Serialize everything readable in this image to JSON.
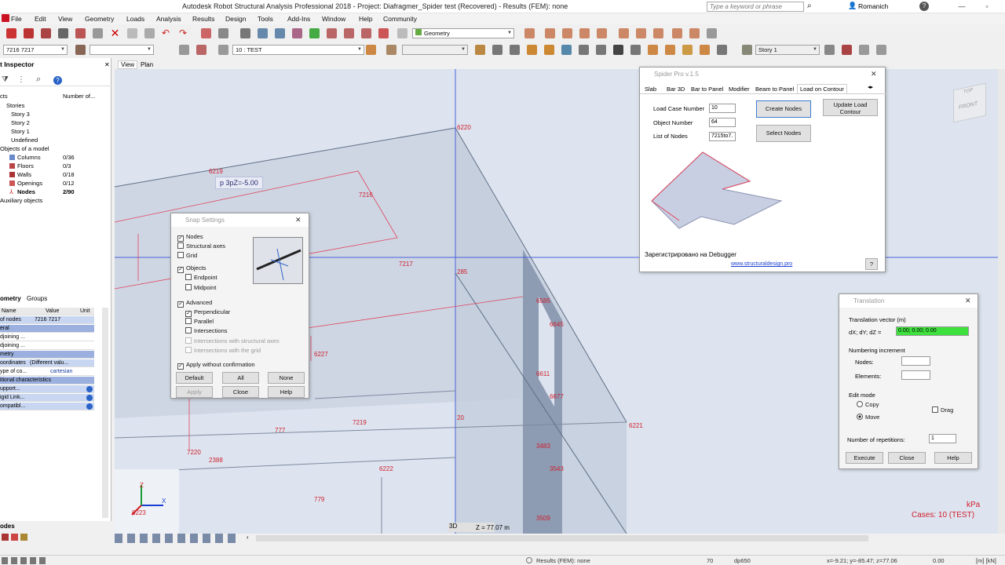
{
  "titlebar": {
    "title": "Autodesk Robot Structural Analysis Professional 2018 - Project: Diafragmer_Spider test (Recovered) - Results (FEM): none",
    "search_placeholder": "Type a keyword or phrase",
    "user": "Romanich"
  },
  "menu": [
    "File",
    "Edit",
    "View",
    "Geometry",
    "Loads",
    "Analysis",
    "Results",
    "Design",
    "Tools",
    "Add-Ins",
    "Window",
    "Help",
    "Community"
  ],
  "toolbar": {
    "geometry_combo": "Geometry",
    "node_combo": "7216 7217",
    "case_combo": "10 : TEST",
    "story_combo": "Story 1"
  },
  "inspector": {
    "title": "t Inspector",
    "col1": "cts",
    "col2": "Number of...",
    "tree": [
      {
        "label": "Stories",
        "count": ""
      },
      {
        "label": "Story 3",
        "count": ""
      },
      {
        "label": "Story 2",
        "count": ""
      },
      {
        "label": "Story 1",
        "count": ""
      },
      {
        "label": "Undefined",
        "count": ""
      },
      {
        "label": "Objects of a model",
        "count": ""
      },
      {
        "label": "Columns",
        "count": "0/36"
      },
      {
        "label": "Floors",
        "count": "0/3"
      },
      {
        "label": "Walls",
        "count": "0/18"
      },
      {
        "label": "Openings",
        "count": "0/12"
      },
      {
        "label": "Nodes",
        "count": "2/90"
      },
      {
        "label": "Auxiliary objects",
        "count": ""
      }
    ]
  },
  "propgrid": {
    "tab1": "ometry",
    "tab2": "Groups",
    "headers": [
      "Name",
      "Value",
      "Unit"
    ],
    "rows": [
      {
        "name": "of nodes",
        "value": "7216 7217",
        "type": "hl"
      },
      {
        "name": "eral",
        "value": "",
        "type": "sec"
      },
      {
        "name": "djoining ...",
        "value": "",
        "type": ""
      },
      {
        "name": "djoining ...",
        "value": "",
        "type": ""
      },
      {
        "name": "metry",
        "value": "",
        "type": "sec"
      },
      {
        "name": "oordinates",
        "value": "(Different valu...",
        "type": "hl"
      },
      {
        "name": "ype of co...",
        "value": "cartesian",
        "type": ""
      },
      {
        "name": "itional characteristics",
        "value": "",
        "type": "sec"
      },
      {
        "name": "upport...",
        "value": "",
        "type": "hl"
      },
      {
        "name": "igid Link...",
        "value": "",
        "type": "hl"
      },
      {
        "name": "ompatibl...",
        "value": "",
        "type": "hl"
      }
    ],
    "bottom_tab": "odes"
  },
  "view_tabs": [
    "View",
    "Plan"
  ],
  "viewport": {
    "nodes": [
      "6220",
      "6219",
      "7216",
      "7217",
      "285",
      "6585",
      "6645",
      "6611",
      "6677",
      "6221",
      "6227",
      "7219",
      "777",
      "7220",
      "2388",
      "6222",
      "3483",
      "3543",
      "779",
      "3509",
      "20",
      "6223"
    ],
    "tooltip": "p 3pZ=-5.00",
    "view_label": "3D",
    "z_label": "Z = 77.07 m",
    "units": "kPa",
    "cases": "Cases: 10 (TEST)",
    "cube_top": "TOP",
    "cube_front": "FRONT"
  },
  "snap": {
    "title": "Snap Settings",
    "nodes": "Nodes",
    "structural_axes": "Structural axes",
    "grid": "Grid",
    "objects": "Objects",
    "endpoint": "Endpoint",
    "midpoint": "Midpoint",
    "advanced": "Advanced",
    "perpendicular": "Perpendicular",
    "parallel": "Parallel",
    "intersections": "Intersections",
    "int_struct": "Intersections with structural axes",
    "int_grid": "Intersections with the grid",
    "apply_wo": "Apply without confirmation",
    "default": "Default",
    "all": "All",
    "none": "None",
    "apply": "Apply",
    "close": "Close",
    "help": "Help"
  },
  "spider": {
    "title": "Spider Pro v.1.5",
    "tabs": [
      "Slab",
      "Bar 3D",
      "Bar to Panel",
      "Modifier",
      "Beam to Panel",
      "Load on Contour"
    ],
    "load_case_label": "Load Case Number",
    "load_case": "10",
    "object_label": "Object Number",
    "object": "64",
    "list_label": "List of Nodes",
    "list": "7215to7.",
    "create": "Create Nodes",
    "update": "Update Load Contour",
    "select": "Select Nodes",
    "registered": "Зарегистрировано на Debugger",
    "link": "www.structuraldesign.pro",
    "help": "?"
  },
  "translation": {
    "title": "Translation",
    "vector_label": "Translation vector (m)",
    "dxdydz": "dX; dY; dZ =",
    "vector": "0.00; 0.00; 0.00",
    "numbering": "Numbering increment",
    "nodes": "Nodes:",
    "elements": "Elements:",
    "edit_mode": "Edit mode",
    "copy": "Copy",
    "move": "Move",
    "drag": "Drag",
    "repetitions_label": "Number of repetitions:",
    "repetitions": "1",
    "execute": "Execute",
    "close": "Close",
    "help": "Help"
  },
  "statusbar": {
    "results": "Results (FEM): none",
    "num": "70",
    "section": "dp650",
    "coords": "x=-9.21; y=-85.47; z=77.06",
    "value": "0.00",
    "units": "[m] [kN]"
  }
}
